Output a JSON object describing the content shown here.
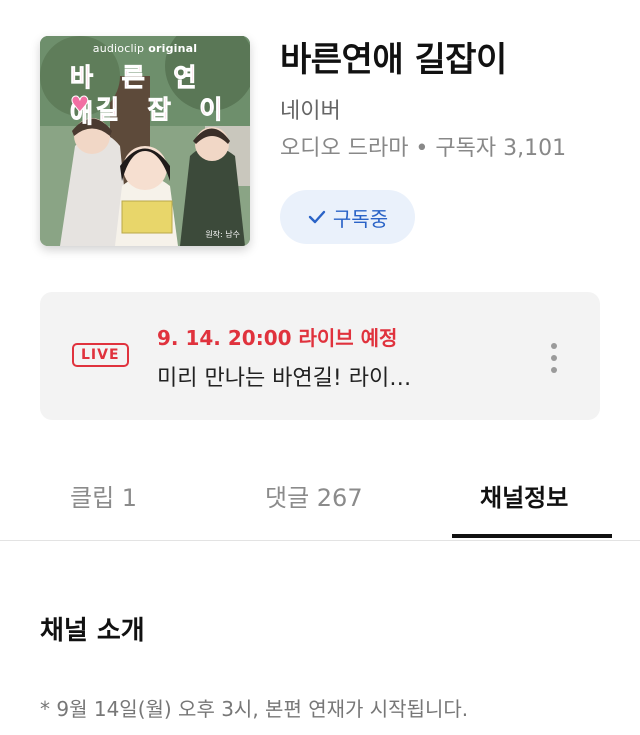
{
  "cover": {
    "brand_prefix": "audioclip",
    "brand_suffix": "original",
    "title_line1": "바 른 연 애",
    "title_line2": "길 잡 이",
    "credit": "원작: 남수"
  },
  "channel": {
    "title": "바른연애 길잡이",
    "publisher": "네이버",
    "meta": "오디오 드라마 • 구독자 3,101",
    "subscribe_label": "구독중"
  },
  "live": {
    "badge": "LIVE",
    "schedule": "9. 14. 20:00 라이브 예정",
    "description": "미리 만나는 바연길! 라이…"
  },
  "tabs": [
    {
      "label": "클립 1",
      "active": false
    },
    {
      "label": "댓글 267",
      "active": false
    },
    {
      "label": "채널정보",
      "active": true
    }
  ],
  "info": {
    "section_title": "채널 소개",
    "intro": "* 9월 14일(월) 오후 3시, 본편 연재가 시작됩니다."
  },
  "colors": {
    "accent_blue": "#2a63c7",
    "live_red": "#e0323d"
  },
  "icons": {
    "check": "check-icon",
    "more": "more-vertical-icon"
  }
}
